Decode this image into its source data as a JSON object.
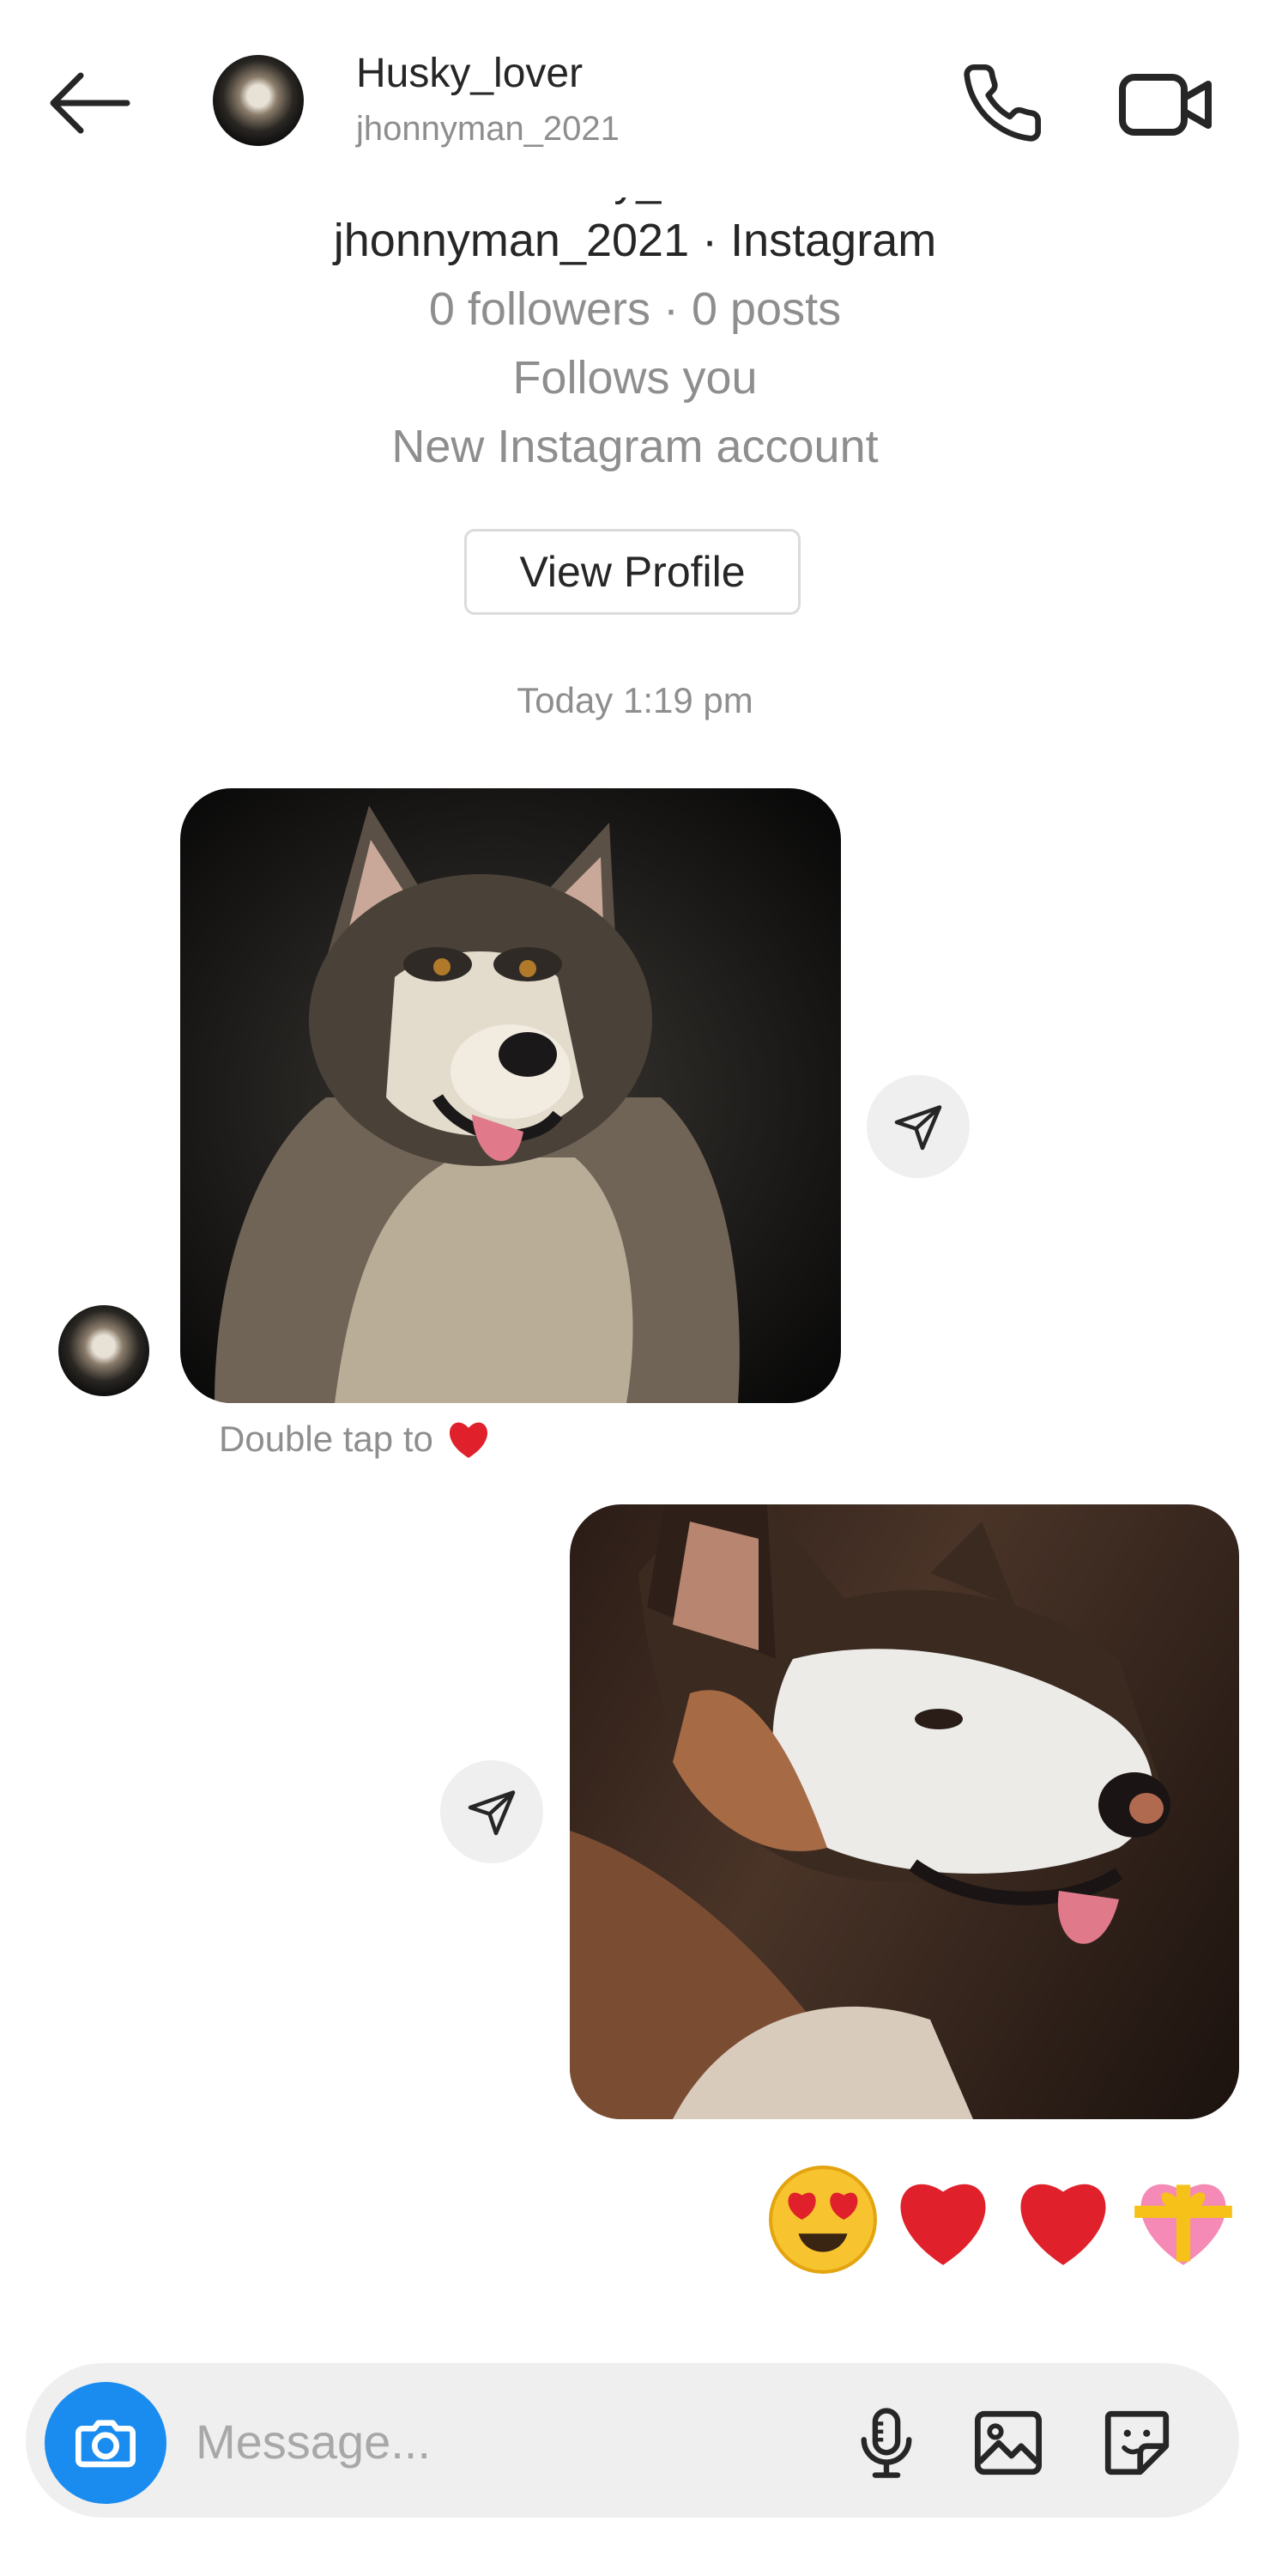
{
  "header": {
    "name": "Husky_lover",
    "username": "jhonnyman_2021",
    "back_icon": "arrow-left-icon",
    "call_icon": "phone-icon",
    "video_icon": "video-camera-icon"
  },
  "profile": {
    "name": "Husky_lover",
    "handle_line": "jhonnyman_2021 · Instagram",
    "stats": "0 followers · 0 posts",
    "follows": "Follows you",
    "note": "New Instagram account",
    "view_profile_label": "View Profile"
  },
  "conversation": {
    "timestamp": "Today 1:19 pm",
    "double_tap_label": "Double tap to",
    "messages": [
      {
        "type": "photo",
        "sender": "them",
        "description_icon": "husky-photo"
      },
      {
        "type": "photo",
        "sender": "me",
        "description_icon": "husky-photo"
      },
      {
        "type": "emoji",
        "sender": "me",
        "emojis": [
          "😍",
          "❤️",
          "❤️",
          "💝"
        ]
      }
    ]
  },
  "composer": {
    "placeholder": "Message...",
    "camera_icon": "camera-icon",
    "mic_icon": "microphone-icon",
    "gallery_icon": "image-icon",
    "sticker_icon": "sticker-icon"
  },
  "colors": {
    "accent": "#1a8cf0",
    "heart": "#e0202a",
    "muted_text": "#8e8e8e",
    "bubble_bg": "#efefef"
  }
}
